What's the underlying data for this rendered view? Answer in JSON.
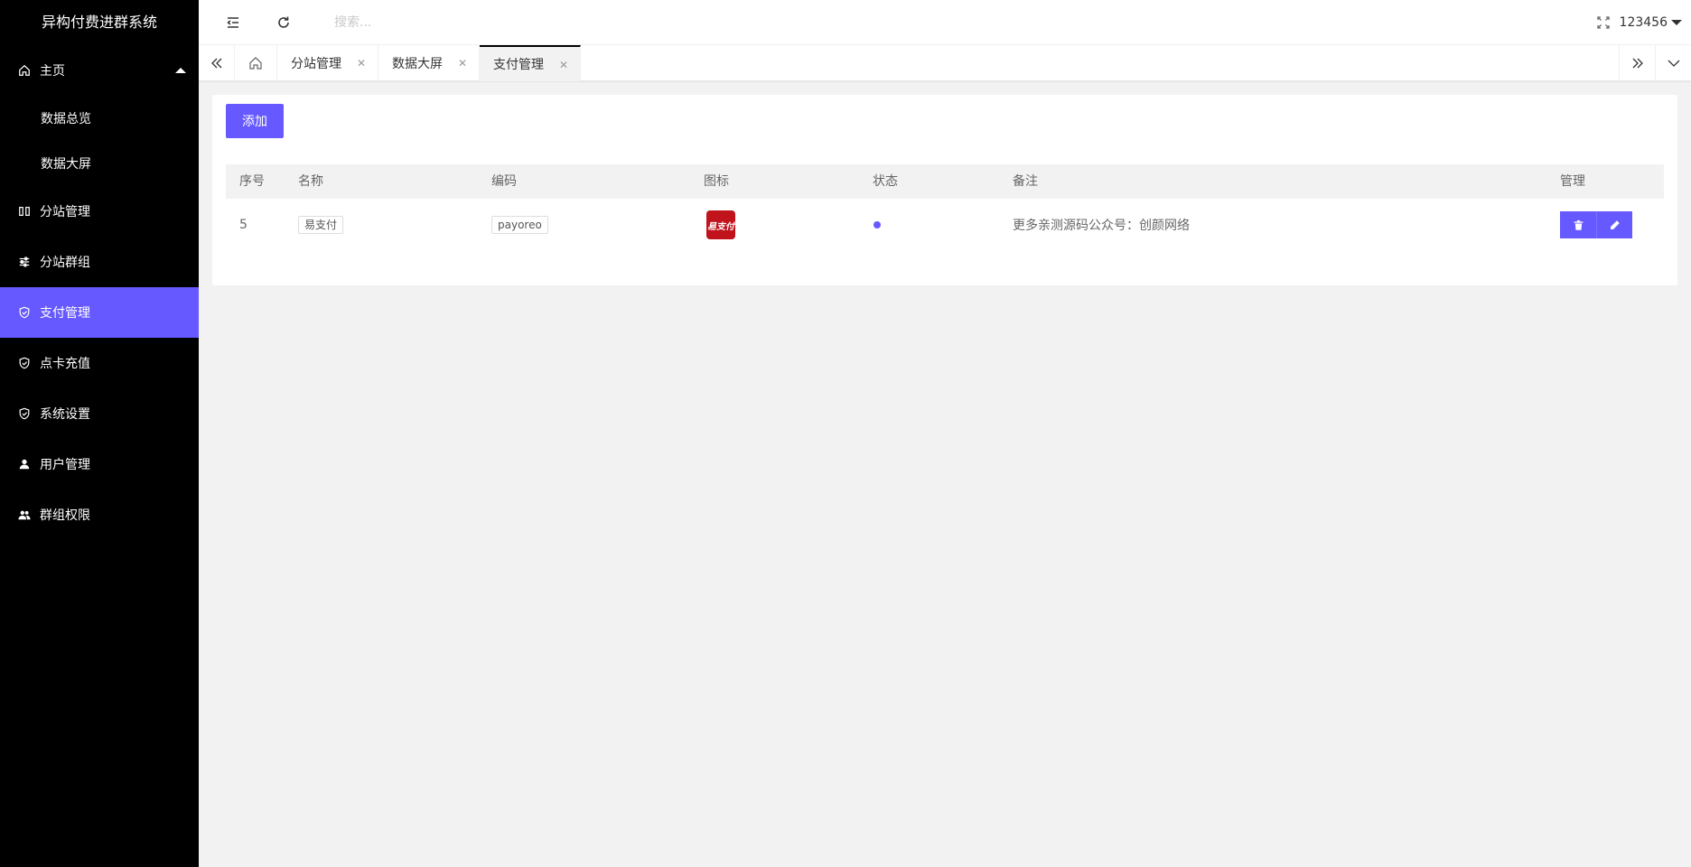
{
  "brand": "异构付费进群系统",
  "sidebar": {
    "home": {
      "label": "主页",
      "icon": "home-icon"
    },
    "home_children": [
      {
        "label": "数据总览"
      },
      {
        "label": "数据大屏"
      }
    ],
    "items": [
      {
        "label": "分站管理",
        "icon": "columns-icon"
      },
      {
        "label": "分站群组",
        "icon": "sliders-icon"
      },
      {
        "label": "支付管理",
        "icon": "shield-check-icon",
        "active": true
      },
      {
        "label": "点卡充值",
        "icon": "shield-check-icon"
      },
      {
        "label": "系统设置",
        "icon": "shield-check-icon"
      },
      {
        "label": "用户管理",
        "icon": "user-icon"
      },
      {
        "label": "群组权限",
        "icon": "users-icon"
      }
    ]
  },
  "header": {
    "search_placeholder": "搜索...",
    "username": "123456"
  },
  "tabs": [
    {
      "label": "分站管理"
    },
    {
      "label": "数据大屏"
    },
    {
      "label": "支付管理",
      "active": true
    }
  ],
  "content": {
    "add_label": "添加",
    "columns": [
      "序号",
      "名称",
      "编码",
      "图标",
      "状态",
      "备注",
      "管理"
    ],
    "rows": [
      {
        "id": "5",
        "name": "易支付",
        "code": "payoreo",
        "icon_text": "易支付",
        "status": "enabled",
        "remark": "更多亲测源码公众号：创颜网络"
      }
    ]
  },
  "colors": {
    "accent": "#6659ff",
    "sidebar_bg": "#000000",
    "logo_red": "#c0131c"
  }
}
